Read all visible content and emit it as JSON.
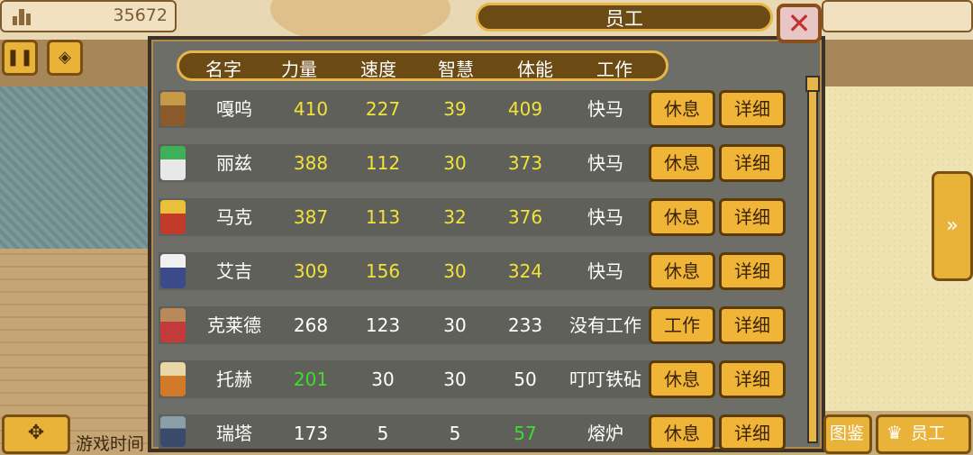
{
  "hud": {
    "money": "35672",
    "money_icon": "building-chart-icon",
    "pause_icon": "pause-icon",
    "map_icon": "map-icon",
    "game_time_label": "游戏时间",
    "partial_button_label": "图鉴",
    "staff_button_label": "员工",
    "staff_icon": "crown-icon",
    "side_arrow_icon": "fast-forward-icon",
    "bottom_left_icon": "dpad-icon"
  },
  "dialog": {
    "title": "员工",
    "close_icon": "close-icon",
    "columns": [
      "名字",
      "力量",
      "速度",
      "智慧",
      "体能",
      "工作"
    ],
    "rest_label": "休息",
    "work_label": "工作",
    "detail_label": "详细",
    "rows": [
      {
        "name": "嘎呜",
        "power": "410",
        "speed": "227",
        "wisdom": "39",
        "stamina": "409",
        "job": "快马",
        "action": "休息",
        "detail": "详细"
      },
      {
        "name": "丽兹",
        "power": "388",
        "speed": "112",
        "wisdom": "30",
        "stamina": "373",
        "job": "快马",
        "action": "休息",
        "detail": "详细"
      },
      {
        "name": "马克",
        "power": "387",
        "speed": "113",
        "wisdom": "32",
        "stamina": "376",
        "job": "快马",
        "action": "休息",
        "detail": "详细"
      },
      {
        "name": "艾吉",
        "power": "309",
        "speed": "156",
        "wisdom": "30",
        "stamina": "324",
        "job": "快马",
        "action": "休息",
        "detail": "详细"
      },
      {
        "name": "克莱德",
        "power": "268",
        "speed": "123",
        "wisdom": "30",
        "stamina": "233",
        "job": "没有工作",
        "action": "工作",
        "detail": "详细"
      },
      {
        "name": "托赫",
        "power": "201",
        "speed": "30",
        "wisdom": "30",
        "stamina": "50",
        "job": "叮叮铁砧",
        "action": "休息",
        "detail": "详细"
      },
      {
        "name": "瑞塔",
        "power": "173",
        "speed": "5",
        "wisdom": "5",
        "stamina": "57",
        "job": "熔炉",
        "action": "休息",
        "detail": "详细"
      }
    ],
    "colors": {
      "value_yellow": "#f2e23a",
      "value_green": "#3fdc2f",
      "value_white": "#ffffff"
    }
  }
}
